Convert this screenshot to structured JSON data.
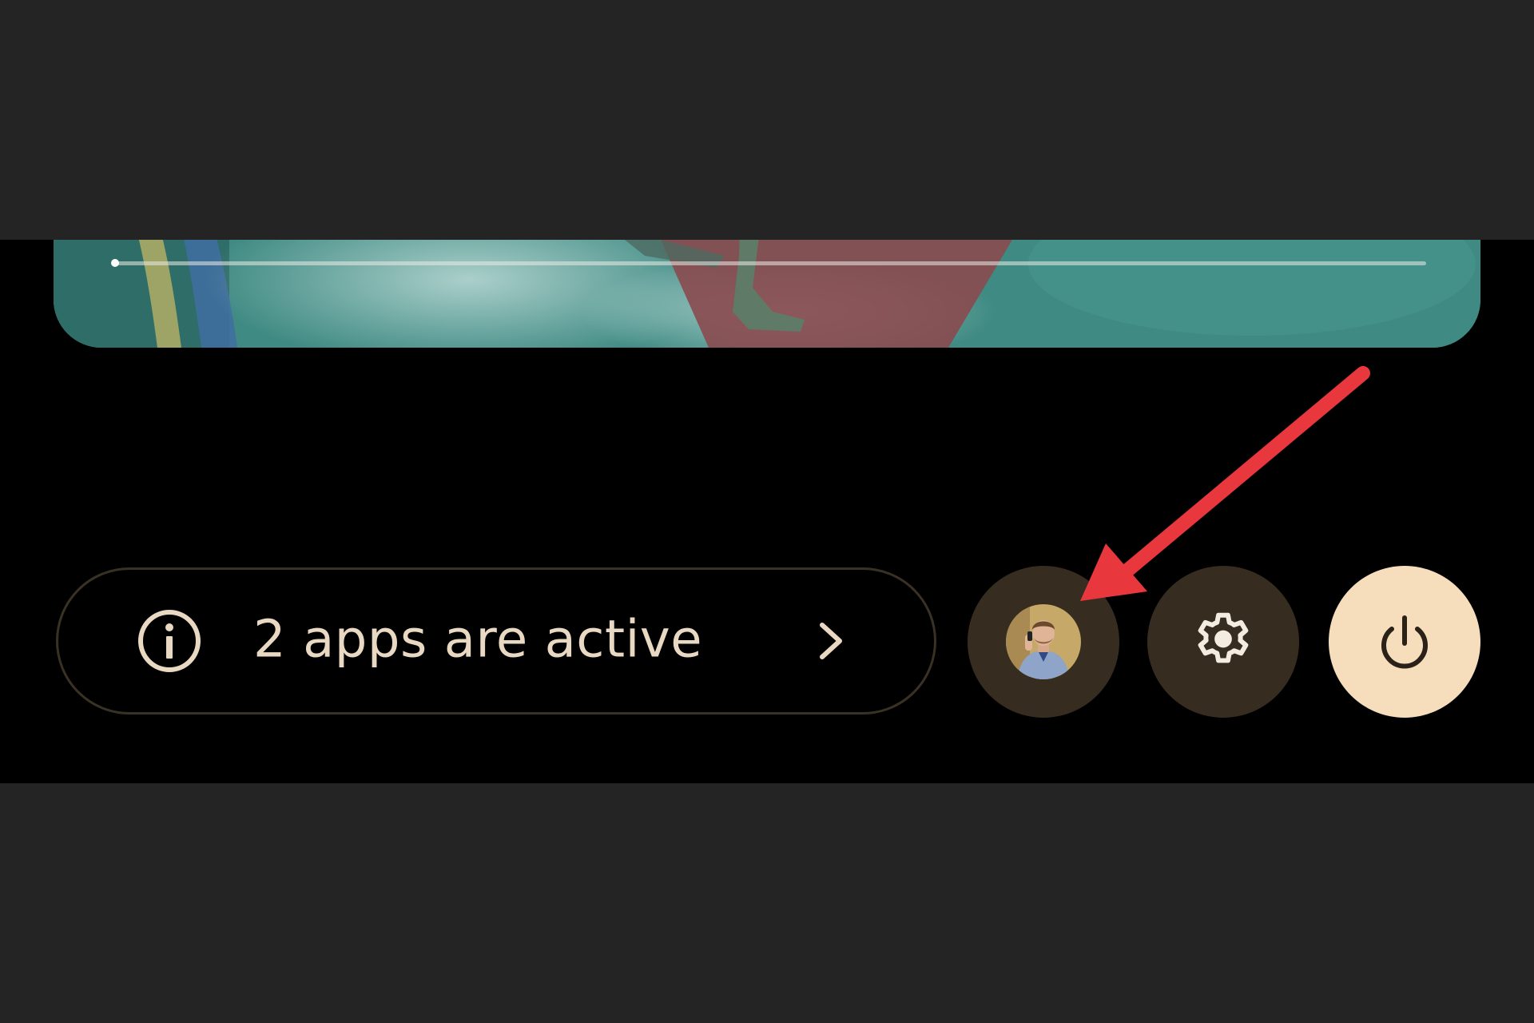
{
  "media": {
    "progress_fraction": 0.0
  },
  "quick_settings_footer": {
    "active_apps_label": "2 apps are active",
    "icons": {
      "info": "info-icon",
      "chevron": "chevron-right-icon",
      "user": "user-avatar",
      "settings": "gear-icon",
      "power": "power-icon"
    }
  },
  "colors": {
    "chip_text": "#e9d8c2",
    "chip_border": "#3a3125",
    "button_bg": "#372c20",
    "power_bg": "#f6ddbb",
    "annotation_arrow": "#e8383d"
  }
}
